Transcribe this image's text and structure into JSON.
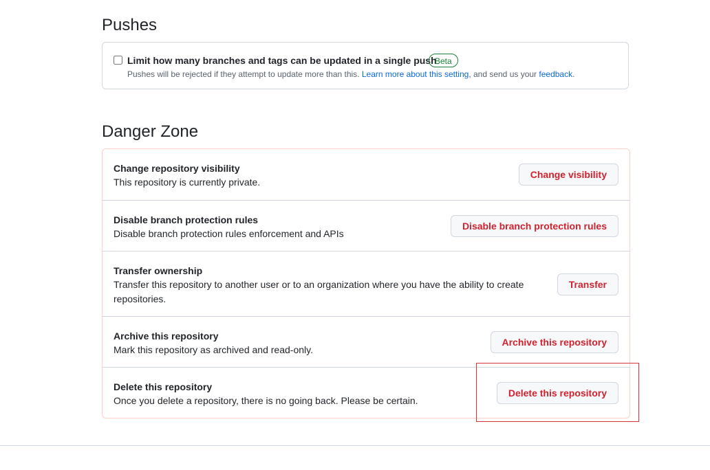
{
  "pushes": {
    "title": "Pushes",
    "limit_label": "Limit how many branches and tags can be updated in a single push",
    "beta_badge": "Beta",
    "note_prefix": "Pushes will be rejected if they attempt to update more than this.",
    "note_link1": "Learn more about this setting",
    "note_middle": ", and send us your",
    "note_link2": "feedback",
    "note_suffix": ".",
    "limit_checked": false
  },
  "danger_zone": {
    "title": "Danger Zone",
    "rows": [
      {
        "title": "Change repository visibility",
        "description": "This repository is currently private.",
        "button": "Change visibility"
      },
      {
        "title": "Disable branch protection rules",
        "description": "Disable branch protection rules enforcement and APIs",
        "button": "Disable branch protection rules"
      },
      {
        "title": "Transfer ownership",
        "description": "Transfer this repository to another user or to an organization where you have the ability to create repositories.",
        "button": "Transfer"
      },
      {
        "title": "Archive this repository",
        "description": "Mark this repository as archived and read-only.",
        "button": "Archive this repository"
      },
      {
        "title": "Delete this repository",
        "description": "Once you delete a repository, there is no going back. Please be certain.",
        "button": "Delete this repository"
      }
    ]
  },
  "colors": {
    "danger_text": "#cf222e",
    "danger_border": "#ffcecb",
    "link": "#0969da",
    "beta": "#1a7f37",
    "highlight": "#d13438"
  }
}
